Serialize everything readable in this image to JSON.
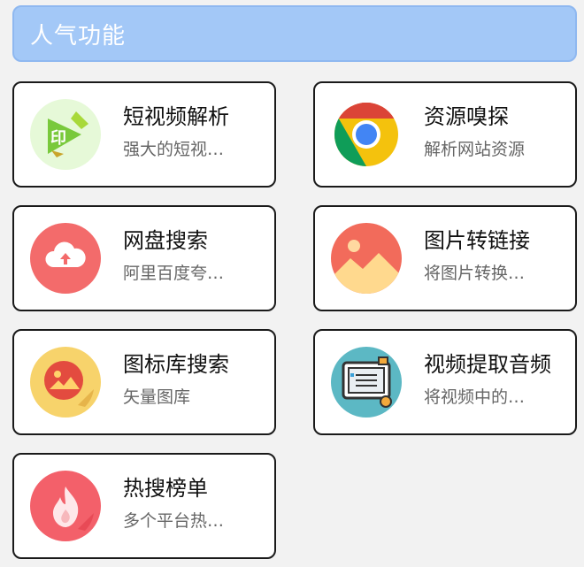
{
  "section": {
    "title": "人气功能"
  },
  "features": [
    {
      "title": "短视频解析",
      "desc": "强大的短视…",
      "icon": "video-parse-icon"
    },
    {
      "title": "资源嗅探",
      "desc": "解析网站资源",
      "icon": "chrome-browser-icon"
    },
    {
      "title": "网盘搜索",
      "desc": "阿里百度夸…",
      "icon": "cloud-upload-icon"
    },
    {
      "title": "图片转链接",
      "desc": "将图片转换…",
      "icon": "landscape-image-icon"
    },
    {
      "title": "图标库搜索",
      "desc": "矢量图库",
      "icon": "icon-library-icon"
    },
    {
      "title": "视频提取音频",
      "desc": "将视频中的…",
      "icon": "audio-extract-icon"
    },
    {
      "title": "热搜榜单",
      "desc": "多个平台热…",
      "icon": "flame-icon"
    }
  ],
  "colors": {
    "header_bg": "#a3c8f7",
    "card_border": "#1a1a1a",
    "page_bg": "#f2f2f2"
  }
}
